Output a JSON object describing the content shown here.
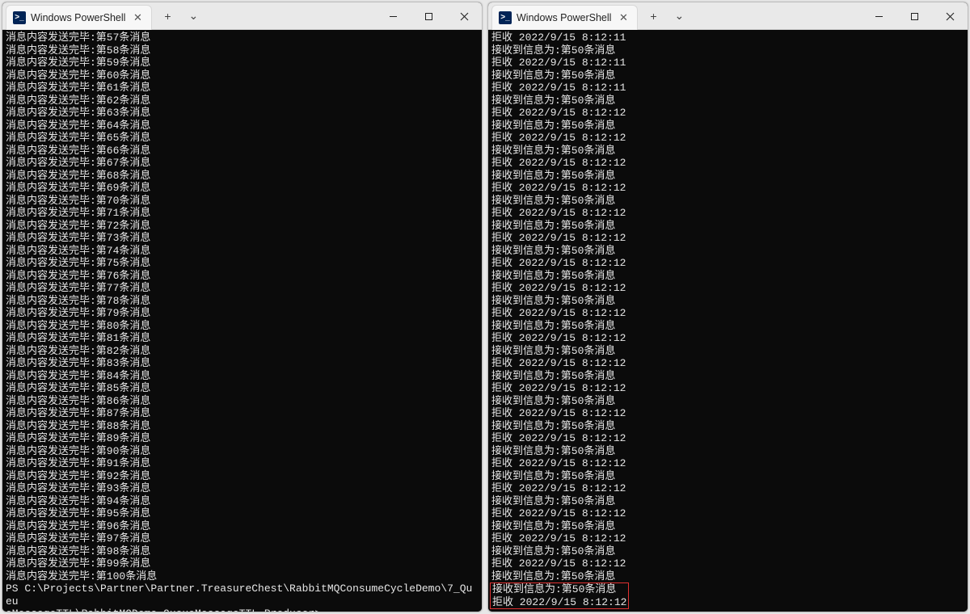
{
  "tab_title": "Windows PowerShell",
  "icons": {
    "ps_glyph": ">_",
    "close_x": "✕",
    "plus": "+",
    "chevron": "⌄"
  },
  "left_terminal": {
    "prefix": "消息内容发送完毕:第",
    "suffix": "条消息",
    "start": 57,
    "end": 100,
    "prompt_lines": [
      "PS C:\\Projects\\Partner\\Partner.TreasureChest\\RabbitMQConsumeCycleDemo\\7_Queu",
      "eMessageTTL\\RabbitMQDemo.QueueMessageTTL.Producer> "
    ]
  },
  "right_terminal": {
    "pairs": [
      {
        "a": "拒收 2022/9/15 8:12:11",
        "b": "接收到信息为:第50条消息"
      },
      {
        "a": "拒收 2022/9/15 8:12:11",
        "b": "接收到信息为:第50条消息"
      },
      {
        "a": "拒收 2022/9/15 8:12:11",
        "b": "接收到信息为:第50条消息"
      },
      {
        "a": "拒收 2022/9/15 8:12:12",
        "b": "接收到信息为:第50条消息"
      },
      {
        "a": "拒收 2022/9/15 8:12:12",
        "b": "接收到信息为:第50条消息"
      },
      {
        "a": "拒收 2022/9/15 8:12:12",
        "b": "接收到信息为:第50条消息"
      },
      {
        "a": "拒收 2022/9/15 8:12:12",
        "b": "接收到信息为:第50条消息"
      },
      {
        "a": "拒收 2022/9/15 8:12:12",
        "b": "接收到信息为:第50条消息"
      },
      {
        "a": "拒收 2022/9/15 8:12:12",
        "b": "接收到信息为:第50条消息"
      },
      {
        "a": "拒收 2022/9/15 8:12:12",
        "b": "接收到信息为:第50条消息"
      },
      {
        "a": "拒收 2022/9/15 8:12:12",
        "b": "接收到信息为:第50条消息"
      },
      {
        "a": "拒收 2022/9/15 8:12:12",
        "b": "接收到信息为:第50条消息"
      },
      {
        "a": "拒收 2022/9/15 8:12:12",
        "b": "接收到信息为:第50条消息"
      },
      {
        "a": "拒收 2022/9/15 8:12:12",
        "b": "接收到信息为:第50条消息"
      },
      {
        "a": "拒收 2022/9/15 8:12:12",
        "b": "接收到信息为:第50条消息"
      },
      {
        "a": "拒收 2022/9/15 8:12:12",
        "b": "接收到信息为:第50条消息"
      },
      {
        "a": "拒收 2022/9/15 8:12:12",
        "b": "接收到信息为:第50条消息"
      },
      {
        "a": "拒收 2022/9/15 8:12:12",
        "b": "接收到信息为:第50条消息"
      },
      {
        "a": "拒收 2022/9/15 8:12:12",
        "b": "接收到信息为:第50条消息"
      },
      {
        "a": "拒收 2022/9/15 8:12:12",
        "b": "接收到信息为:第50条消息"
      },
      {
        "a": "拒收 2022/9/15 8:12:12",
        "b": "接收到信息为:第50条消息"
      },
      {
        "a": "拒收 2022/9/15 8:12:12",
        "b": "接收到信息为:第50条消息"
      }
    ],
    "highlight": {
      "a": "接收到信息为:第50条消息",
      "b": "拒收 2022/9/15 8:12:12"
    }
  }
}
